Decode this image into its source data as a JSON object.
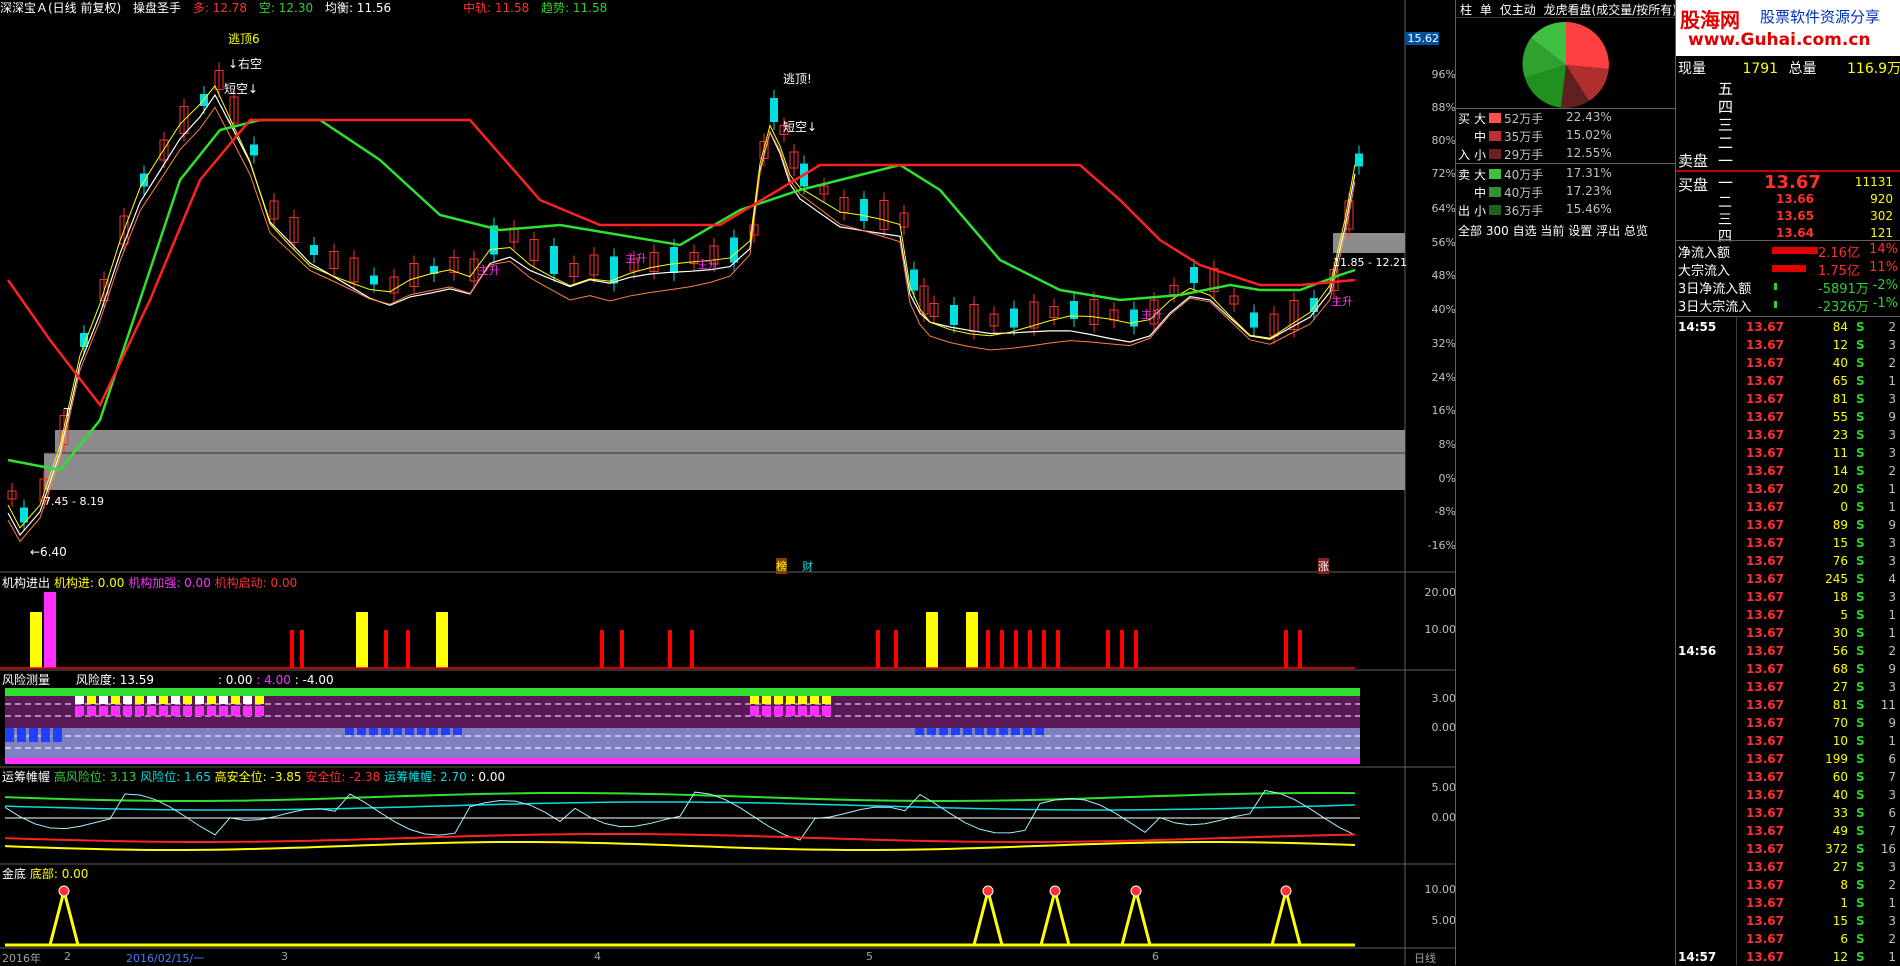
{
  "header": {
    "stock": "深深宝Ａ(日线 前复权)",
    "indicator": "操盘圣手",
    "duo": "多: 12.78",
    "kong": "空: 12.30",
    "junheng": "均衡: 11.56",
    "zhonggui": "中轨: 11.58",
    "qushi": "趋势: 11.58",
    "arrow": "↑"
  },
  "price_axis": [
    "15.62",
    "96%",
    "88%",
    "80%",
    "72%",
    "64%",
    "56%",
    "48%",
    "40%",
    "32%",
    "24%",
    "16%",
    "8%",
    "0%",
    "-8%",
    "-16%"
  ],
  "main_annotations": {
    "taodinga": "逃顶6",
    "youkong": "↓右空",
    "duankong1": "短空↓",
    "taodingb": "逃顶!",
    "duankong2": "短空↓",
    "low_price": "←6.40",
    "range_left": "7.45 - 8.19",
    "range_right": "11.85 - 12.21",
    "zhusheng": "主升",
    "bang": "榜",
    "cai": "财",
    "zhang": "涨",
    "high_mark": "T"
  },
  "panel1": {
    "name": "机构进出",
    "a": "机构进: 0.00",
    "b": "机构加强: 0.00",
    "c": "机构启动: 0.00",
    "axis": [
      "20.00",
      "10.00"
    ]
  },
  "panel2": {
    "name": "风险测量",
    "a": "风险度: 13.59",
    "b": ": 0.00",
    "c": ": 4.00",
    "d": ": -4.00",
    "axis": [
      "3.00",
      "0.00"
    ]
  },
  "panel3": {
    "name": "运筹帷幄",
    "a": "高风险位: 3.13",
    "b": "风险位: 1.65",
    "c": "高安全位: -3.85",
    "d": "安全位: -2.38",
    "e": "运筹帷幄: 2.70",
    "f": ": 0.00",
    "axis": [
      "5.00",
      "0.00"
    ]
  },
  "panel4": {
    "name": "金底",
    "a": "底部: 0.00",
    "axis": [
      "10.00",
      "5.00"
    ]
  },
  "x_axis": {
    "year": "2016年",
    "m2": "2",
    "date": "2016/02/15/一",
    "m3": "3",
    "m4": "4",
    "m5": "5",
    "m6": "6",
    "period": "日线"
  },
  "flow_tabs": [
    "柱",
    "单",
    "仅主动",
    "龙虎看盘(成交量/按所有)"
  ],
  "flow_rows": [
    {
      "side": "买",
      "size": "大",
      "vol": "52万手",
      "pct": "22.43%",
      "color": "#ff5050"
    },
    {
      "side": "",
      "size": "中",
      "vol": "35万手",
      "pct": "15.02%",
      "color": "#c03030"
    },
    {
      "side": "入",
      "size": "小",
      "vol": "29万手",
      "pct": "12.55%",
      "color": "#702020"
    },
    {
      "side": "卖",
      "size": "大",
      "vol": "40万手",
      "pct": "17.31%",
      "color": "#40c040"
    },
    {
      "side": "",
      "size": "中",
      "vol": "40万手",
      "pct": "17.23%",
      "color": "#309030"
    },
    {
      "side": "出",
      "size": "小",
      "vol": "36万手",
      "pct": "15.46%",
      "color": "#206020"
    }
  ],
  "flow_footer": [
    "全部",
    "300",
    "自选",
    "当前",
    "设置",
    "浮出",
    "总览"
  ],
  "logo": {
    "title": "股海网",
    "sub": "股票软件资源分享",
    "url": "www.Guhai.com.cn"
  },
  "quote": {
    "xianliang": "现量",
    "xianliang_val": "1791",
    "zongliang": "总量",
    "zongliang_val": "116.9万",
    "sell_levels": [
      "五",
      "四",
      "三",
      "二"
    ],
    "maipan": "卖盘",
    "yi": "一",
    "maipan_buy": "买盘",
    "buy": [
      {
        "lvl": "一",
        "price": "13.67",
        "vol": "11131"
      },
      {
        "lvl": "二",
        "price": "13.66",
        "vol": "920"
      },
      {
        "lvl": "三",
        "price": "13.65",
        "vol": "302"
      },
      {
        "lvl": "四",
        "price": "13.64",
        "vol": "121"
      }
    ],
    "flows": [
      {
        "label": "净流入额",
        "val": "2.16亿",
        "pct": "14%"
      },
      {
        "label": "大宗流入",
        "val": "1.75亿",
        "pct": "11%"
      },
      {
        "label": "3日净流入额",
        "val": "-5891万",
        "pct": "-2%"
      },
      {
        "label": "3日大宗流入",
        "val": "-2326万",
        "pct": "-1%"
      }
    ]
  },
  "ticks": [
    {
      "time": "14:55",
      "price": "13.67",
      "vol": "84",
      "bs": "S",
      "n": "2"
    },
    {
      "time": "",
      "price": "13.67",
      "vol": "12",
      "bs": "S",
      "n": "3"
    },
    {
      "time": "",
      "price": "13.67",
      "vol": "40",
      "bs": "S",
      "n": "2"
    },
    {
      "time": "",
      "price": "13.67",
      "vol": "65",
      "bs": "S",
      "n": "1"
    },
    {
      "time": "",
      "price": "13.67",
      "vol": "81",
      "bs": "S",
      "n": "3"
    },
    {
      "time": "",
      "price": "13.67",
      "vol": "55",
      "bs": "S",
      "n": "9"
    },
    {
      "time": "",
      "price": "13.67",
      "vol": "23",
      "bs": "S",
      "n": "3"
    },
    {
      "time": "",
      "price": "13.67",
      "vol": "11",
      "bs": "S",
      "n": "3"
    },
    {
      "time": "",
      "price": "13.67",
      "vol": "14",
      "bs": "S",
      "n": "2"
    },
    {
      "time": "",
      "price": "13.67",
      "vol": "20",
      "bs": "S",
      "n": "1"
    },
    {
      "time": "",
      "price": "13.67",
      "vol": "0",
      "bs": "S",
      "n": "1"
    },
    {
      "time": "",
      "price": "13.67",
      "vol": "89",
      "bs": "S",
      "n": "9"
    },
    {
      "time": "",
      "price": "13.67",
      "vol": "15",
      "bs": "S",
      "n": "3"
    },
    {
      "time": "",
      "price": "13.67",
      "vol": "76",
      "bs": "S",
      "n": "3"
    },
    {
      "time": "",
      "price": "13.67",
      "vol": "245",
      "bs": "S",
      "n": "4"
    },
    {
      "time": "",
      "price": "13.67",
      "vol": "18",
      "bs": "S",
      "n": "3"
    },
    {
      "time": "",
      "price": "13.67",
      "vol": "5",
      "bs": "S",
      "n": "1"
    },
    {
      "time": "",
      "price": "13.67",
      "vol": "30",
      "bs": "S",
      "n": "1"
    },
    {
      "time": "14:56",
      "price": "13.67",
      "vol": "56",
      "bs": "S",
      "n": "2"
    },
    {
      "time": "",
      "price": "13.67",
      "vol": "68",
      "bs": "S",
      "n": "9"
    },
    {
      "time": "",
      "price": "13.67",
      "vol": "27",
      "bs": "S",
      "n": "3"
    },
    {
      "time": "",
      "price": "13.67",
      "vol": "81",
      "bs": "S",
      "n": "11"
    },
    {
      "time": "",
      "price": "13.67",
      "vol": "70",
      "bs": "S",
      "n": "9"
    },
    {
      "time": "",
      "price": "13.67",
      "vol": "10",
      "bs": "S",
      "n": "1"
    },
    {
      "time": "",
      "price": "13.67",
      "vol": "199",
      "bs": "S",
      "n": "6"
    },
    {
      "time": "",
      "price": "13.67",
      "vol": "60",
      "bs": "S",
      "n": "7"
    },
    {
      "time": "",
      "price": "13.67",
      "vol": "40",
      "bs": "S",
      "n": "3"
    },
    {
      "time": "",
      "price": "13.67",
      "vol": "33",
      "bs": "S",
      "n": "6"
    },
    {
      "time": "",
      "price": "13.67",
      "vol": "49",
      "bs": "S",
      "n": "7"
    },
    {
      "time": "",
      "price": "13.67",
      "vol": "372",
      "bs": "S",
      "n": "16"
    },
    {
      "time": "",
      "price": "13.67",
      "vol": "27",
      "bs": "S",
      "n": "3"
    },
    {
      "time": "",
      "price": "13.67",
      "vol": "8",
      "bs": "S",
      "n": "2"
    },
    {
      "time": "",
      "price": "13.67",
      "vol": "1",
      "bs": "S",
      "n": "1"
    },
    {
      "time": "",
      "price": "13.67",
      "vol": "15",
      "bs": "S",
      "n": "3"
    },
    {
      "time": "",
      "price": "13.67",
      "vol": "6",
      "bs": "S",
      "n": "2"
    },
    {
      "time": "14:57",
      "price": "13.67",
      "vol": "12",
      "bs": "S",
      "n": "1"
    }
  ]
}
